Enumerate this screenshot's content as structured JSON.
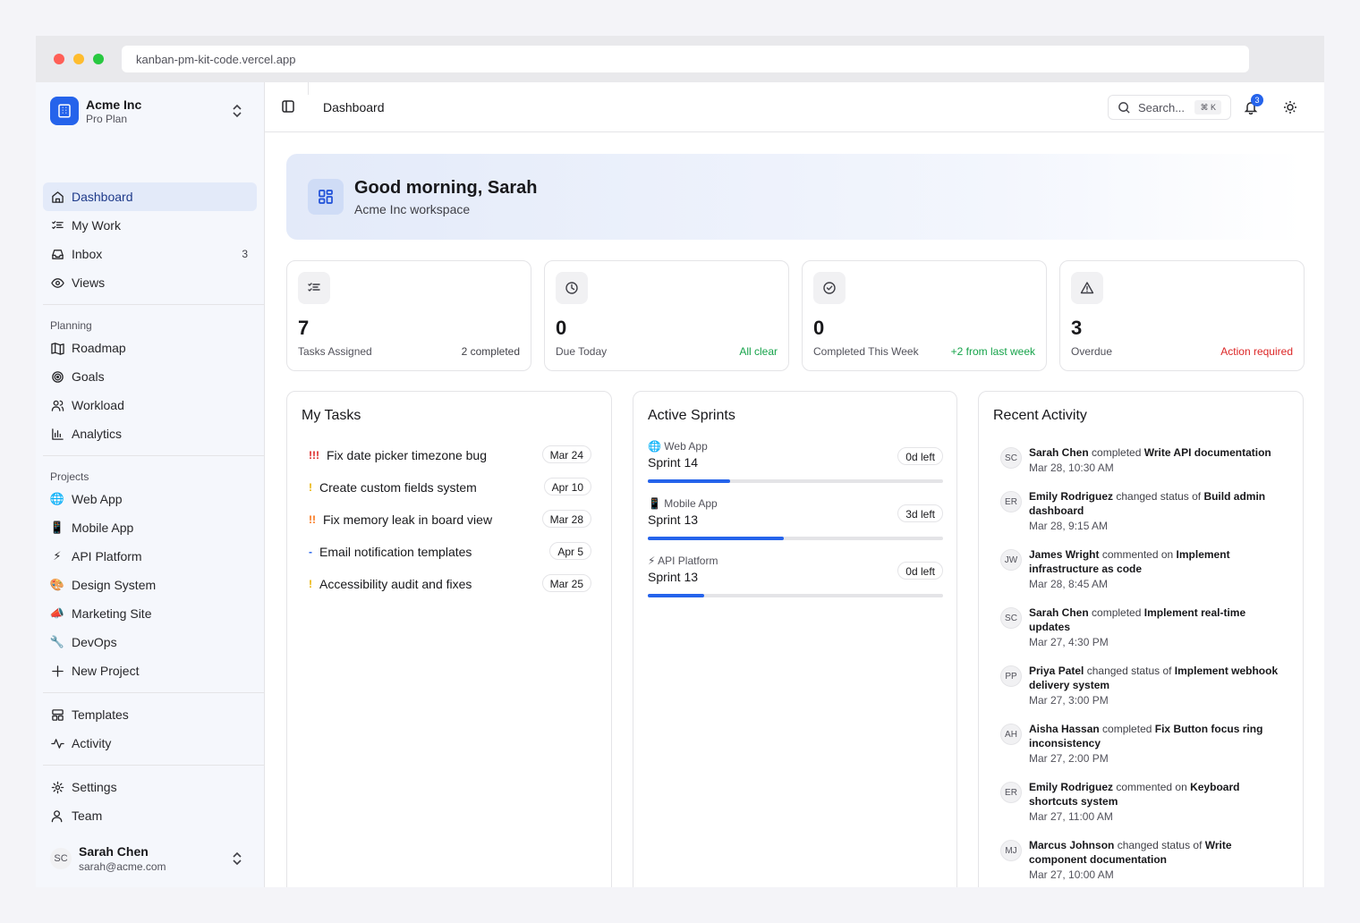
{
  "browser": {
    "url": "kanban-pm-kit-code.vercel.app"
  },
  "workspace": {
    "name": "Acme Inc",
    "plan": "Pro Plan"
  },
  "nav": {
    "main": [
      {
        "label": "Dashboard",
        "icon": "home-icon",
        "active": true
      },
      {
        "label": "My Work",
        "icon": "checklist-icon"
      },
      {
        "label": "Inbox",
        "icon": "inbox-icon",
        "count": "3"
      },
      {
        "label": "Views",
        "icon": "eye-icon"
      }
    ],
    "planning_label": "Planning",
    "planning": [
      {
        "label": "Roadmap",
        "icon": "map-icon"
      },
      {
        "label": "Goals",
        "icon": "target-icon"
      },
      {
        "label": "Workload",
        "icon": "users-icon"
      },
      {
        "label": "Analytics",
        "icon": "bar-chart-icon"
      }
    ],
    "projects_label": "Projects",
    "projects": [
      {
        "label": "Web App",
        "icon": "globe-emoji"
      },
      {
        "label": "Mobile App",
        "icon": "phone-emoji"
      },
      {
        "label": "API Platform",
        "icon": "lightning-emoji"
      },
      {
        "label": "Design System",
        "icon": "palette-emoji"
      },
      {
        "label": "Marketing Site",
        "icon": "megaphone-emoji"
      },
      {
        "label": "DevOps",
        "icon": "wrench-emoji"
      },
      {
        "label": "New Project",
        "icon": "plus-icon"
      }
    ],
    "other": [
      {
        "label": "Templates",
        "icon": "template-icon"
      },
      {
        "label": "Activity",
        "icon": "activity-icon"
      }
    ],
    "settings": [
      {
        "label": "Settings",
        "icon": "gear-icon"
      },
      {
        "label": "Team",
        "icon": "team-icon"
      }
    ]
  },
  "user": {
    "initials": "SC",
    "name": "Sarah Chen",
    "email": "sarah@acme.com"
  },
  "header": {
    "breadcrumb": "Dashboard",
    "search_placeholder": "Search...",
    "search_shortcut": "⌘ K",
    "notifications": "3"
  },
  "hero": {
    "title": "Good morning, Sarah",
    "subtitle": "Acme Inc workspace"
  },
  "stats": [
    {
      "value": "7",
      "label": "Tasks Assigned",
      "note": "2 completed",
      "note_color": "#3f3f46",
      "icon": "checklist-icon"
    },
    {
      "value": "0",
      "label": "Due Today",
      "note": "All clear",
      "note_color": "#16a34a",
      "icon": "clock-icon"
    },
    {
      "value": "0",
      "label": "Completed This Week",
      "note": "+2 from last week",
      "note_color": "#16a34a",
      "icon": "check-circle-icon"
    },
    {
      "value": "3",
      "label": "Overdue",
      "note": "Action required",
      "note_color": "#dc2626",
      "icon": "warning-icon"
    }
  ],
  "my_tasks": {
    "title": "My Tasks",
    "items": [
      {
        "priority": "!!!",
        "color": "#dc2626",
        "name": "Fix date picker timezone bug",
        "due": "Mar 24"
      },
      {
        "priority": "!",
        "color": "#eab308",
        "name": "Create custom fields system",
        "due": "Apr 10"
      },
      {
        "priority": "!!",
        "color": "#f97316",
        "name": "Fix memory leak in board view",
        "due": "Mar 28"
      },
      {
        "priority": "-",
        "color": "#2563eb",
        "name": "Email notification templates",
        "due": "Apr 5"
      },
      {
        "priority": "!",
        "color": "#eab308",
        "name": "Accessibility audit and fixes",
        "due": "Mar 25"
      }
    ]
  },
  "sprints": {
    "title": "Active Sprints",
    "items": [
      {
        "project": "Web App",
        "icon": "🌐",
        "name": "Sprint 14",
        "left": "0d left",
        "progress": 0.28
      },
      {
        "project": "Mobile App",
        "icon": "📱",
        "name": "Sprint 13",
        "left": "3d left",
        "progress": 0.46
      },
      {
        "project": "API Platform",
        "icon": "⚡",
        "name": "Sprint 13",
        "left": "0d left",
        "progress": 0.19
      }
    ]
  },
  "activity": {
    "title": "Recent Activity",
    "items": [
      {
        "initials": "SC",
        "user": "Sarah Chen",
        "action": "completed",
        "target": "Write API documentation",
        "time": "Mar 28, 10:30 AM"
      },
      {
        "initials": "ER",
        "user": "Emily Rodriguez",
        "action": "changed status of",
        "target": "Build admin dashboard",
        "time": "Mar 28, 9:15 AM"
      },
      {
        "initials": "JW",
        "user": "James Wright",
        "action": "commented on",
        "target": "Implement infrastructure as code",
        "time": "Mar 28, 8:45 AM"
      },
      {
        "initials": "SC",
        "user": "Sarah Chen",
        "action": "completed",
        "target": "Implement real-time updates",
        "time": "Mar 27, 4:30 PM"
      },
      {
        "initials": "PP",
        "user": "Priya Patel",
        "action": "changed status of",
        "target": "Implement webhook delivery system",
        "time": "Mar 27, 3:00 PM"
      },
      {
        "initials": "AH",
        "user": "Aisha Hassan",
        "action": "completed",
        "target": "Fix Button focus ring inconsistency",
        "time": "Mar 27, 2:00 PM"
      },
      {
        "initials": "ER",
        "user": "Emily Rodriguez",
        "action": "commented on",
        "target": "Keyboard shortcuts system",
        "time": "Mar 27, 11:00 AM"
      },
      {
        "initials": "MJ",
        "user": "Marcus Johnson",
        "action": "changed status of",
        "target": "Write component documentation",
        "time": "Mar 27, 10:00 AM"
      }
    ]
  }
}
